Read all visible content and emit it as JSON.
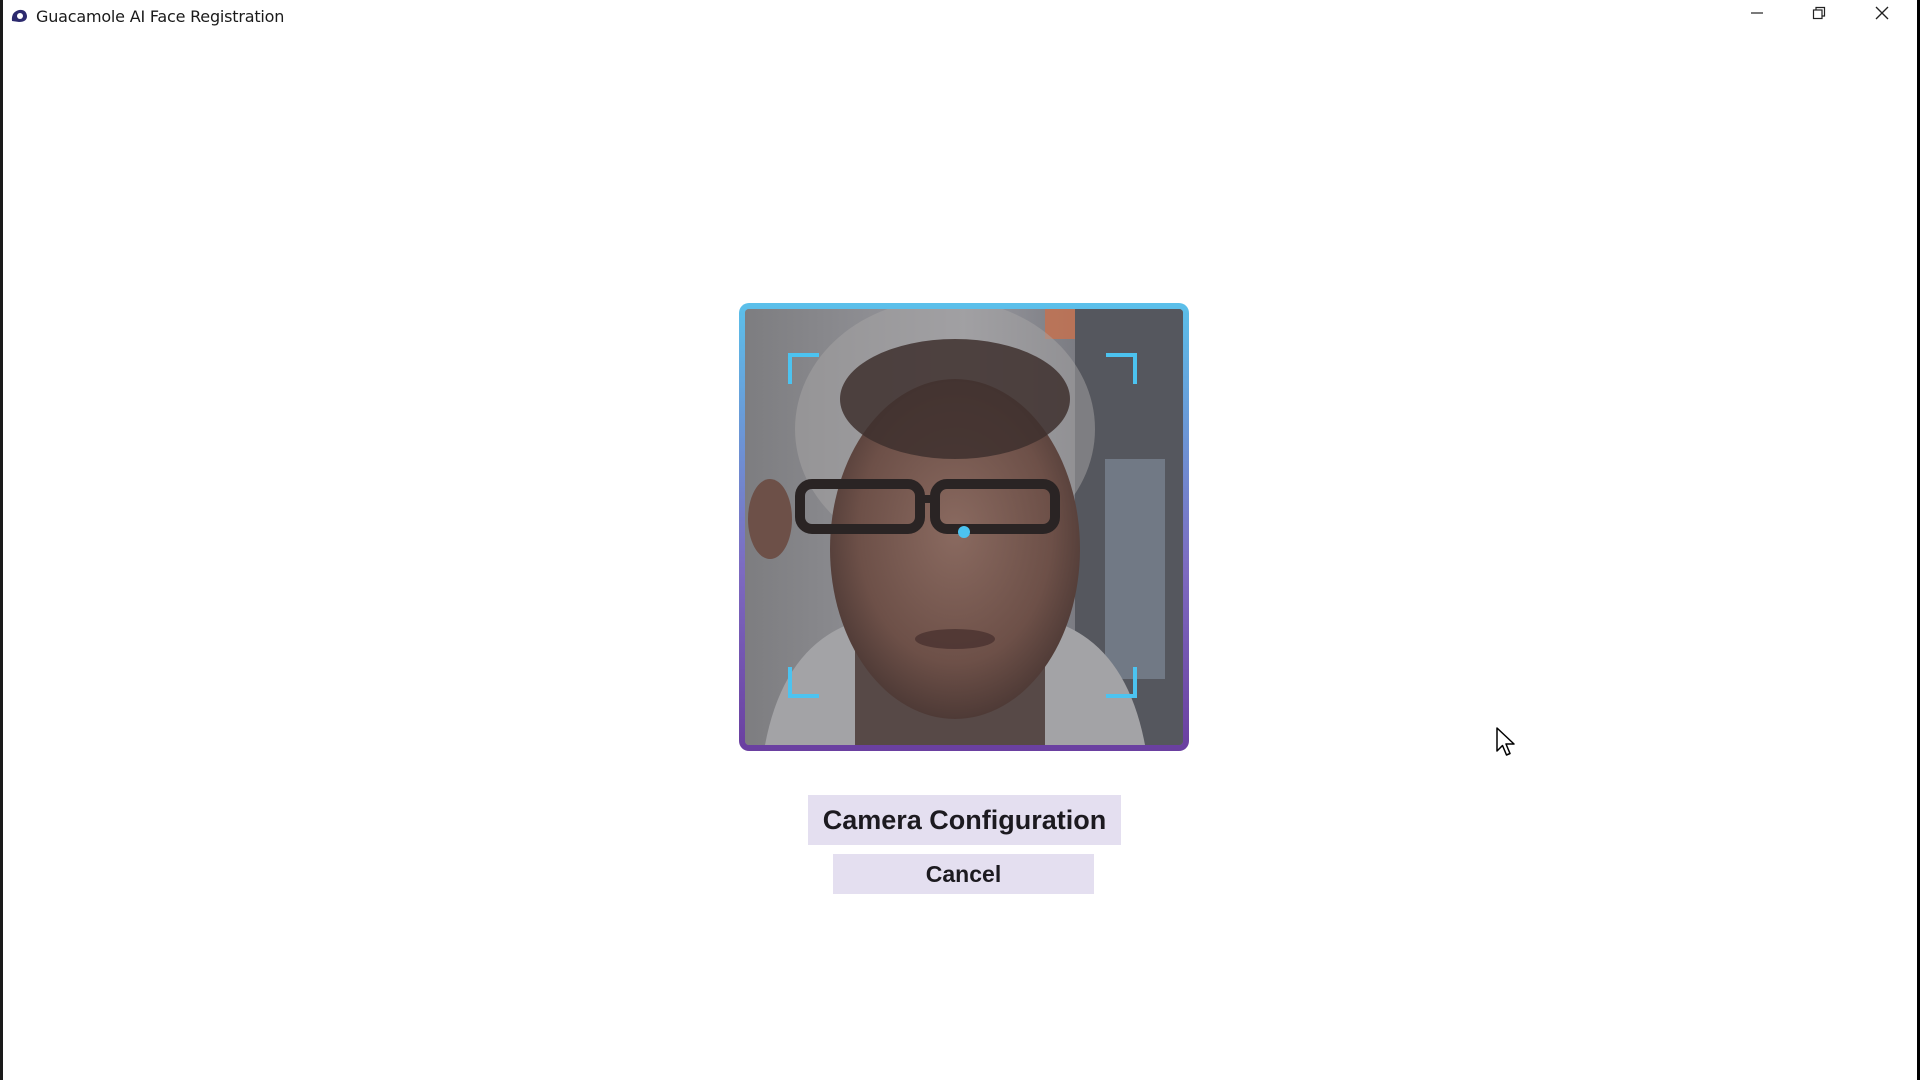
{
  "window": {
    "title": "Guacamole AI Face Registration",
    "icons": {
      "app": "app-logo-icon",
      "minimize": "minimize-icon",
      "restore": "restore-icon",
      "close": "close-icon"
    }
  },
  "camera": {
    "preview": "live-camera-preview",
    "frame_gradient": [
      "#5bc0ea",
      "#6a3fa0"
    ],
    "guide_color": "#4cc3f0"
  },
  "actions": {
    "camera_config_label": "Camera Configuration",
    "cancel_label": "Cancel"
  },
  "colors": {
    "button_bg": "#e4dff0",
    "accent": "#4cc3f0"
  }
}
